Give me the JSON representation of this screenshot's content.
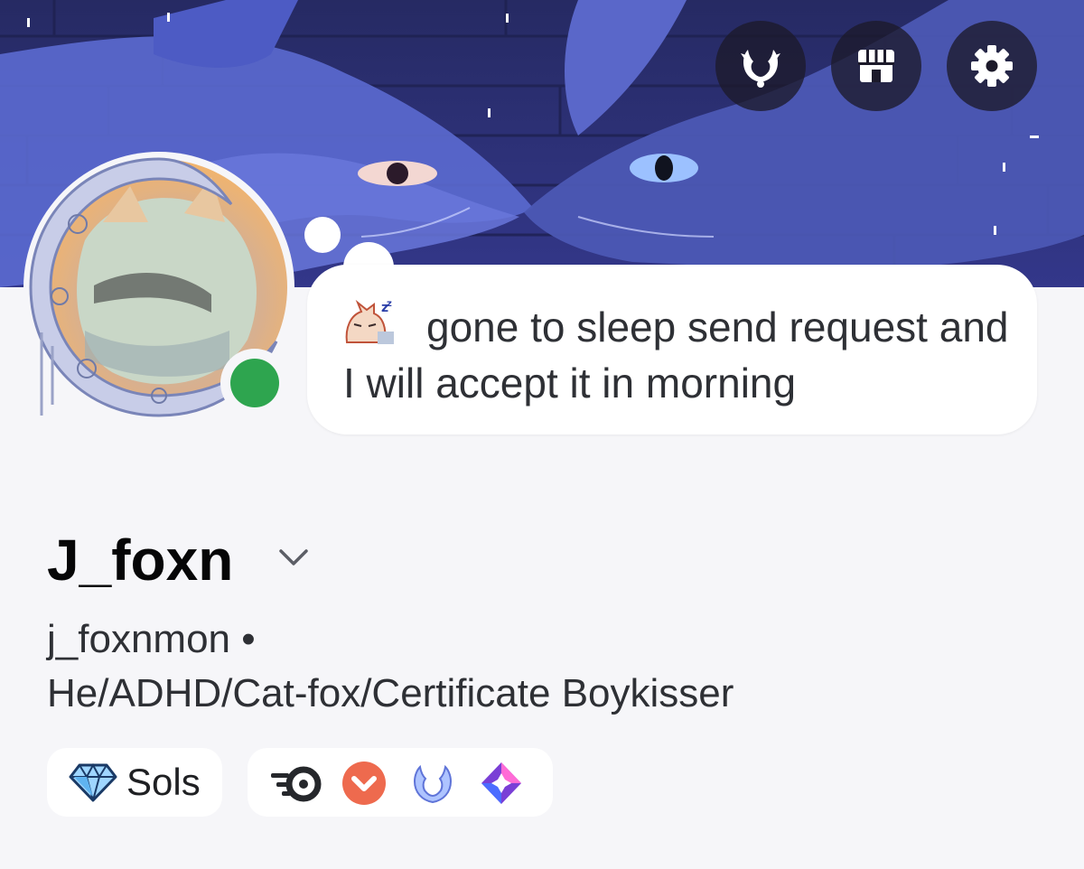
{
  "header": {
    "buttons": [
      {
        "name": "nitro-badge-button",
        "icon": "laurel-wreath-icon"
      },
      {
        "name": "shop-button",
        "icon": "shop-icon"
      },
      {
        "name": "settings-button",
        "icon": "gear-icon"
      }
    ]
  },
  "profile": {
    "status": "online",
    "status_color": "#2ea54f",
    "custom_status": {
      "emoji": "sleeping-fox-emoji",
      "text": "gone to sleep send request and I will accept it in morning"
    },
    "display_name": "J_foxn",
    "username": "j_foxnmon",
    "separator": "•",
    "pronouns": "He/ADHD/Cat-fox/Certificate Boykisser",
    "guild_tag": {
      "icon": "diamond-icon",
      "label": "Sols"
    },
    "badges": [
      {
        "name": "hypesquad-speed-badge",
        "icon": "speed-ring-icon"
      },
      {
        "name": "quest-badge",
        "icon": "chevron-circle-icon"
      },
      {
        "name": "nitro-badge",
        "icon": "laurel-wreath-icon"
      },
      {
        "name": "server-boost-badge",
        "icon": "gem-icon"
      }
    ]
  }
}
